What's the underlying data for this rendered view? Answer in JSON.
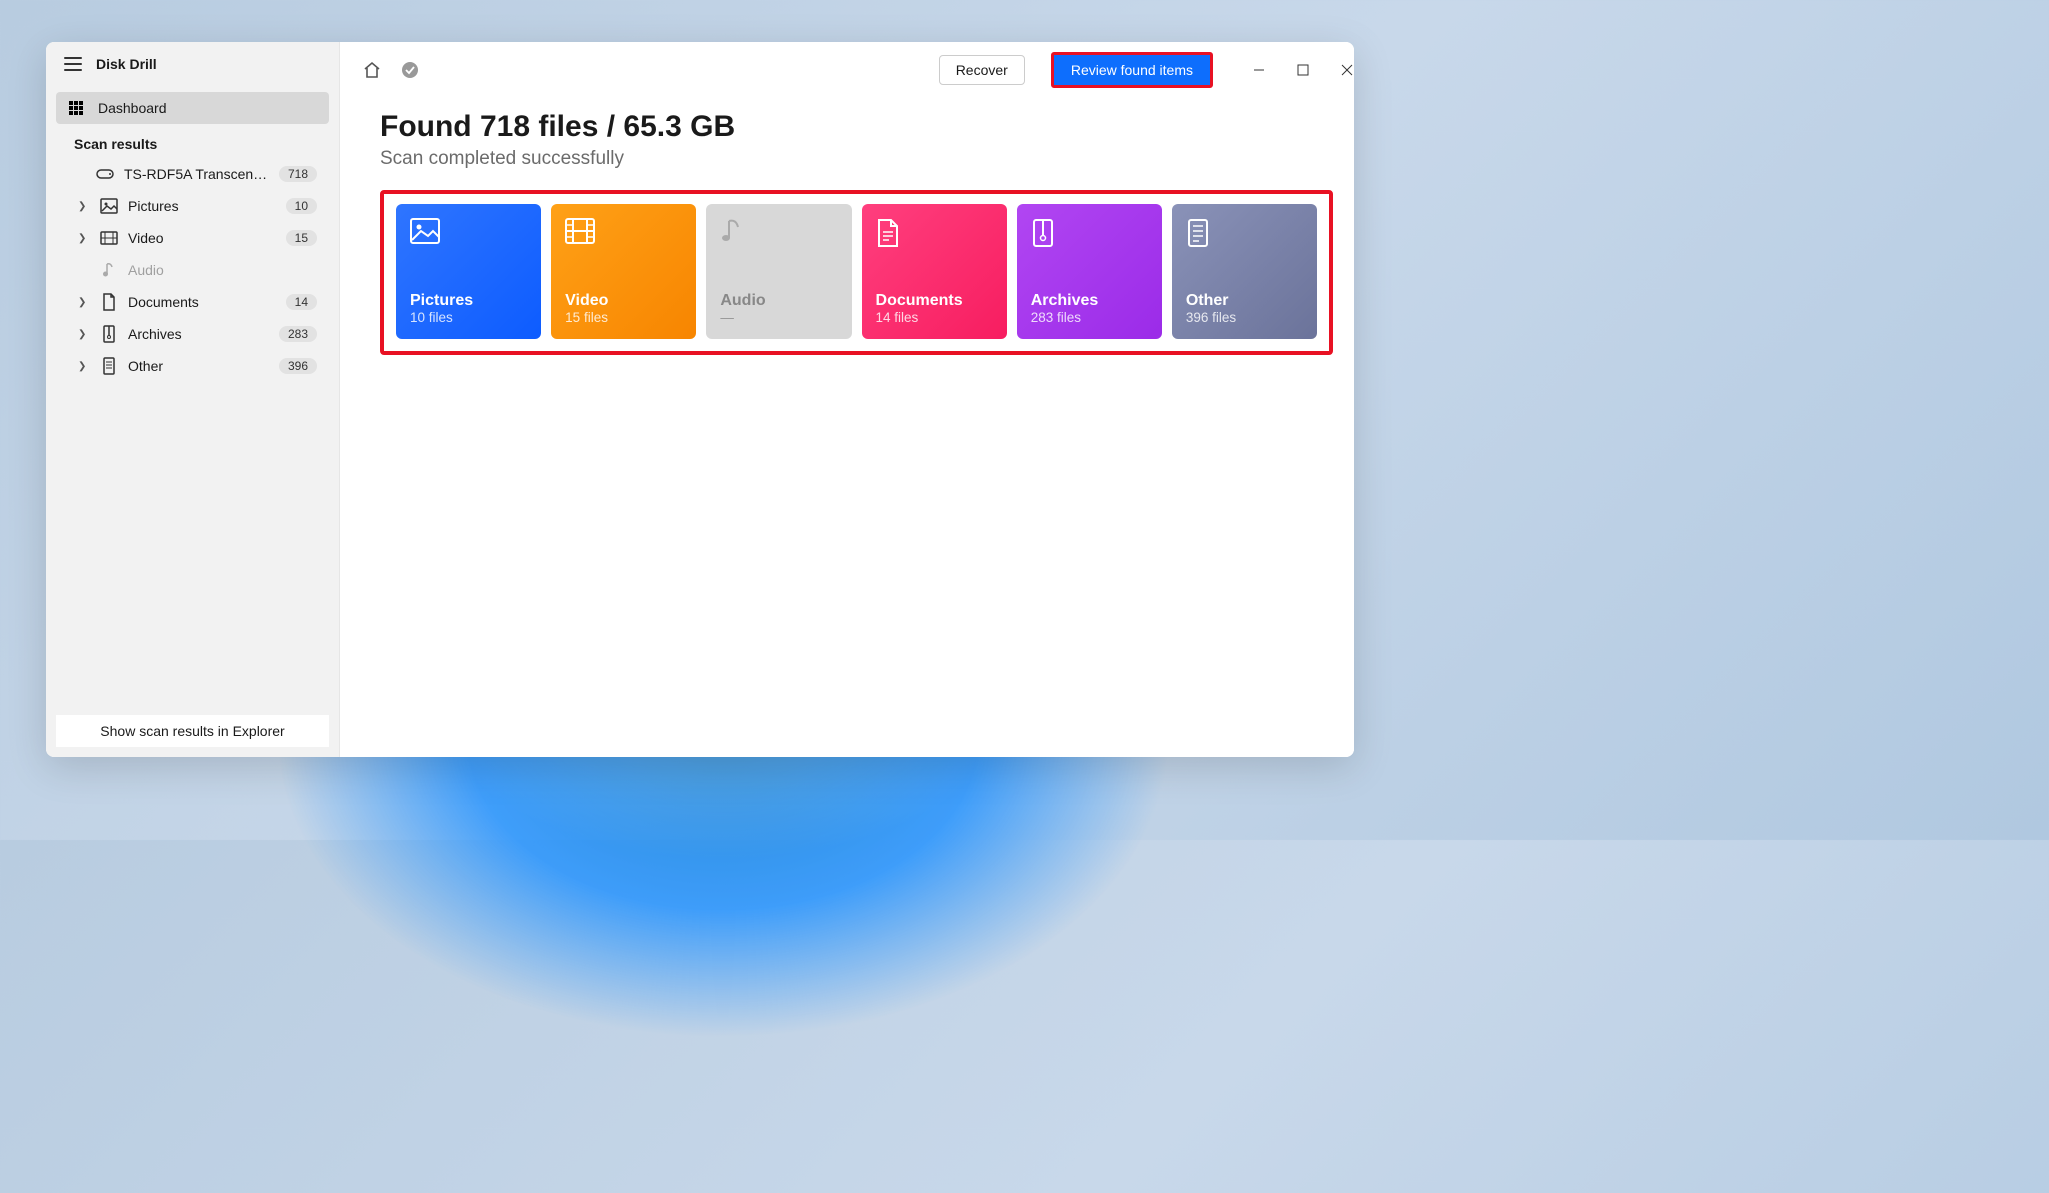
{
  "app_title": "Disk Drill",
  "sidebar": {
    "dashboard_label": "Dashboard",
    "scan_results_label": "Scan results",
    "device": {
      "label": "TS-RDF5A Transcend US...",
      "count": "718"
    },
    "items": [
      {
        "label": "Pictures",
        "count": "10"
      },
      {
        "label": "Video",
        "count": "15"
      },
      {
        "label": "Audio",
        "count": ""
      },
      {
        "label": "Documents",
        "count": "14"
      },
      {
        "label": "Archives",
        "count": "283"
      },
      {
        "label": "Other",
        "count": "396"
      }
    ],
    "footer_button": "Show scan results in Explorer"
  },
  "toolbar": {
    "recover_label": "Recover",
    "review_label": "Review found items"
  },
  "main": {
    "headline": "Found 718 files / 65.3 GB",
    "subheadline": "Scan completed successfully"
  },
  "cards": [
    {
      "title": "Pictures",
      "sub": "10 files"
    },
    {
      "title": "Video",
      "sub": "15 files"
    },
    {
      "title": "Audio",
      "sub": "—"
    },
    {
      "title": "Documents",
      "sub": "14 files"
    },
    {
      "title": "Archives",
      "sub": "283 files"
    },
    {
      "title": "Other",
      "sub": "396 files"
    }
  ]
}
